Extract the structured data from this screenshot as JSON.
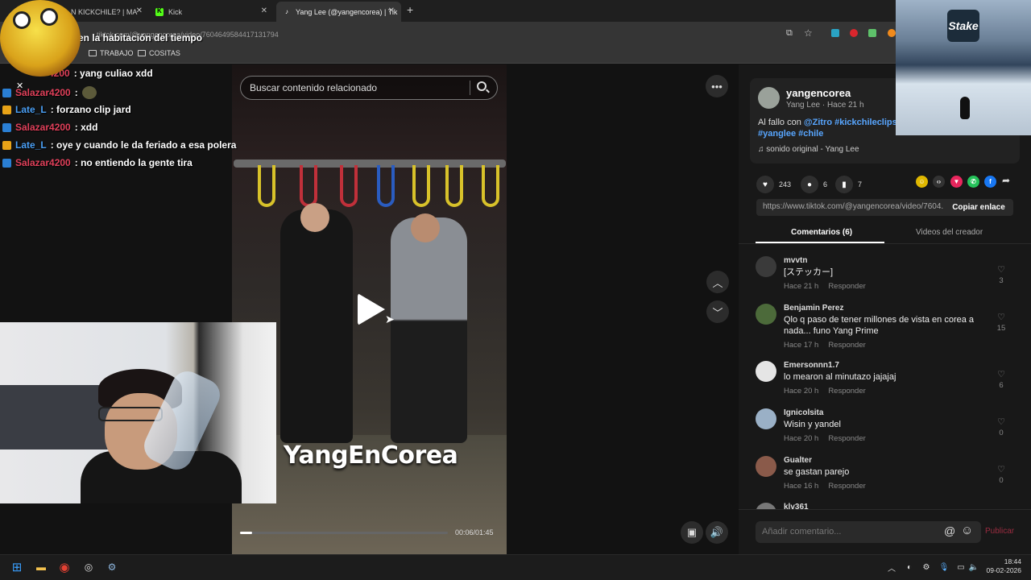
{
  "browser": {
    "tabs": [
      {
        "title": "N KICKCHILE? | MA"
      },
      {
        "title": "Kick"
      },
      {
        "title": "Yang Lee (@yangencorea) | Tik"
      }
    ],
    "new_tab": "+",
    "url": "tiktok.com/@yangencorea/video/7604649584417131794",
    "bookmarks": [
      "TRABAJO",
      "COSITAS"
    ]
  },
  "video": {
    "search_placeholder": "Buscar contenido relacionado",
    "watermark": "YangEnCorea",
    "time": "00:06/01:45",
    "progress": 0.057
  },
  "post": {
    "username": "yangencorea",
    "subtitle": "Yang Lee · Hace 21 h",
    "description_prefix": "Al fallo con ",
    "description_tags": "@Zitro #kickchileclips #yanglee #chile",
    "music": "sonido original - Yang Lee",
    "likes": "243",
    "comments_count": "6",
    "saves": "7",
    "link": "https://www.tiktok.com/@yangencorea/video/7604...",
    "copy_label": "Copiar enlace",
    "tab_comments": "Comentarios (6)",
    "tab_videos": "Videos del creador",
    "comment_placeholder": "Añadir comentario...",
    "publish_label": "Publicar",
    "reply_label": "Responder"
  },
  "comments": [
    {
      "name": "mvvtn",
      "text": "[ステッカー]",
      "time": "Hace 21 h",
      "likes": "3"
    },
    {
      "name": "Benjamin Perez",
      "text": "Qlo q paso de tener millones de vista en corea a nada... funo Yang Prime",
      "time": "Hace 17 h",
      "likes": "15"
    },
    {
      "name": "Emersonnn1.7",
      "text": "lo mearon al minutazo jajajaj",
      "time": "Hace 20 h",
      "likes": "6"
    },
    {
      "name": "Ignicolsita",
      "text": "Wisin y yandel",
      "time": "Hace 20 h",
      "likes": "0"
    },
    {
      "name": "Gualter",
      "text": "se gastan parejo",
      "time": "Hace 16 h",
      "likes": "0"
    },
    {
      "name": "klv361",
      "text": "",
      "time": "",
      "likes": ""
    }
  ],
  "chat": [
    {
      "user": "",
      "msg": "en la habitación del tiempo",
      "color": "#ffffff"
    },
    {
      "user": "4200",
      "msg": ": yang culiao xdd",
      "color": "#e0405a"
    },
    {
      "user": "Salazar4200",
      "msg": ":",
      "color": "#e0405a"
    },
    {
      "user": "Late_L",
      "msg": ": forzano clip jard",
      "color": "#4a9ff5"
    },
    {
      "user": "Salazar4200",
      "msg": ": xdd",
      "color": "#e0405a"
    },
    {
      "user": "Late_L",
      "msg": ": oye y cuando le da feriado a esa polera",
      "color": "#4a9ff5"
    },
    {
      "user": "Salazar4200",
      "msg": ": no entiendo la gente tira",
      "color": "#e0405a"
    }
  ],
  "sponsor": {
    "logo": "Stake"
  },
  "taskbar": {
    "time": "18:44",
    "date": "09-02-2026"
  }
}
